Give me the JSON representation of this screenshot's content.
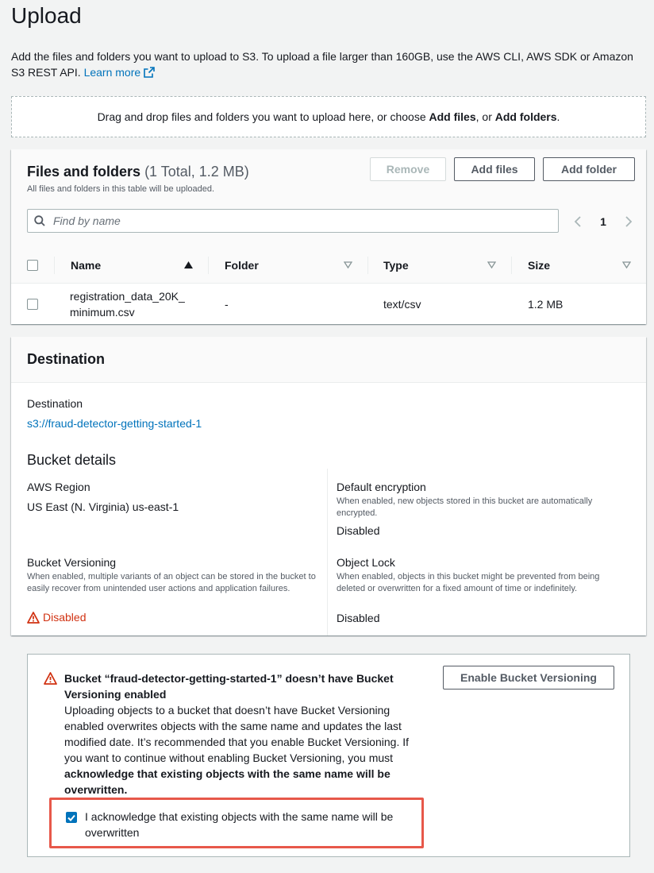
{
  "page": {
    "title": "Upload",
    "intro_text": "Add the files and folders you want to upload to S3. To upload a file larger than 160GB, use the AWS CLI, AWS SDK or Amazon S3 REST API.",
    "learn_more": "Learn more",
    "dropzone": {
      "prefix": "Drag and drop files and folders you want to upload here, or choose ",
      "add_files": "Add files",
      "middle": ", or ",
      "add_folders": "Add folders",
      "suffix": "."
    }
  },
  "files_panel": {
    "title": "Files and folders",
    "count": "(1 Total, 1.2 MB)",
    "subtitle": "All files and folders in this table will be uploaded.",
    "buttons": {
      "remove": "Remove",
      "add_files": "Add files",
      "add_folder": "Add folder"
    },
    "search_placeholder": "Find by name",
    "page_number": "1",
    "columns": [
      "Name",
      "Folder",
      "Type",
      "Size"
    ],
    "rows": [
      {
        "name_line1": "registration_data_20K_",
        "name_line2": "minimum.csv",
        "folder": "-",
        "type": "text/csv",
        "size": "1.2 MB"
      }
    ]
  },
  "destination": {
    "section_title": "Destination",
    "dest_label": "Destination",
    "dest_value": "s3://fraud-detector-getting-started-1",
    "bucket_details_title": "Bucket details",
    "region_label": "AWS Region",
    "region_value": "US East (N. Virginia) us-east-1",
    "encryption_label": "Default encryption",
    "encryption_desc": "When enabled, new objects stored in this bucket are automatically encrypted.",
    "encryption_value": "Disabled",
    "versioning_label": "Bucket Versioning",
    "versioning_desc": "When enabled, multiple variants of an object can be stored in the bucket to easily recover from unintended user actions and application failures.",
    "versioning_value": "Disabled",
    "lock_label": "Object Lock",
    "lock_desc": "When enabled, objects in this bucket might be prevented from being deleted or overwritten for a fixed amount of time or indefinitely.",
    "lock_value": "Disabled"
  },
  "alert": {
    "title": "Bucket “fraud-detector-getting-started-1” doesn’t have Bucket Versioning enabled",
    "body": "Uploading objects to a bucket that doesn’t have Bucket Versioning enabled overwrites objects with the same name and updates the last modified date. It’s recommended that you enable Bucket Versioning. If you want to continue without enabling Bucket Versioning, you must ",
    "body_bold": "acknowledge that existing objects with the same name will be overwritten.",
    "enable_button": "Enable Bucket Versioning",
    "ack_label": "I acknowledge that existing objects with the same name will be overwritten",
    "ack_checked": true
  },
  "colors": {
    "link": "#0073bb",
    "warning": "#d13212",
    "highlight": "#e7584a",
    "background": "#f2f3f3"
  }
}
